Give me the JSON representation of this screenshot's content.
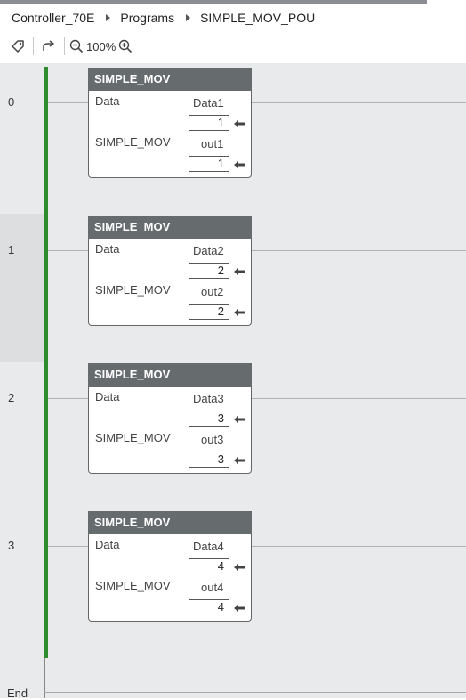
{
  "breadcrumb": {
    "items": [
      "Controller_70E",
      "Programs",
      "SIMPLE_MOV_POU"
    ]
  },
  "toolbar": {
    "zoom": "100%",
    "icons": [
      "tag-icon",
      "redo-icon",
      "zoom-out-icon",
      "zoom-in-icon"
    ]
  },
  "rungs": [
    {
      "number": "0",
      "block": {
        "title": "SIMPLE_MOV",
        "in_pin": "Data",
        "name_label": "SIMPLE_MOV",
        "var1": "Data1",
        "val1": "1",
        "var2": "out1",
        "val2": "1"
      }
    },
    {
      "number": "1",
      "block": {
        "title": "SIMPLE_MOV",
        "in_pin": "Data",
        "name_label": "SIMPLE_MOV",
        "var1": "Data2",
        "val1": "2",
        "var2": "out2",
        "val2": "2"
      }
    },
    {
      "number": "2",
      "block": {
        "title": "SIMPLE_MOV",
        "in_pin": "Data",
        "name_label": "SIMPLE_MOV",
        "var1": "Data3",
        "val1": "3",
        "var2": "out3",
        "val2": "3"
      }
    },
    {
      "number": "3",
      "block": {
        "title": "SIMPLE_MOV",
        "in_pin": "Data",
        "name_label": "SIMPLE_MOV",
        "var1": "Data4",
        "val1": "4",
        "var2": "out4",
        "val2": "4"
      }
    }
  ],
  "end_label": "End",
  "colors": {
    "rail": "#2e8b2e",
    "header": "#666b6e",
    "canvas": "#e8eaeb",
    "rung_highlight": "#dcdedf"
  }
}
